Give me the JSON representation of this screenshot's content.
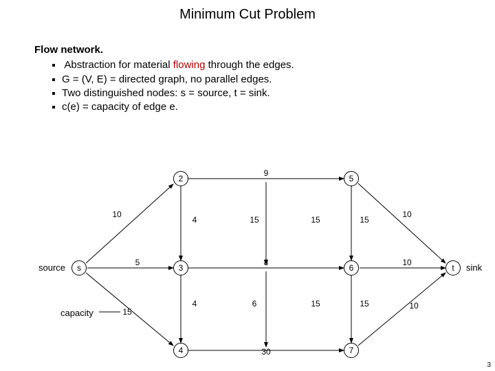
{
  "title": "Minimum Cut Problem",
  "heading": "Flow network.",
  "bullets": [
    {
      "pre": "Abstraction for material ",
      "em": "flowing",
      "post": " through the edges."
    },
    {
      "pre": "G = (V, E) = directed graph, no parallel edges.",
      "em": "",
      "post": ""
    },
    {
      "pre": "Two distinguished nodes:  s = source, t = sink.",
      "em": "",
      "post": ""
    },
    {
      "pre": "c(e) = capacity of edge e.",
      "em": "",
      "post": ""
    }
  ],
  "labels": {
    "source": "source",
    "sink": "sink",
    "capacity": "capacity"
  },
  "nodes": {
    "s": "s",
    "2": "2",
    "3": "3",
    "4": "4",
    "5": "5",
    "6": "6",
    "7": "7",
    "t": "t"
  },
  "edges": {
    "s_2": "10",
    "s_3": "5",
    "s_4": "15",
    "2_3": "4",
    "3_4": "4",
    "2_5": "9",
    "3_6": "8",
    "4_7": "30",
    "2_9_mid_a": "15",
    "2_9_mid_b": "15",
    "3_6_mid_a": "6",
    "3_6_mid_b": "15",
    "5_t": "10",
    "6_t": "10",
    "7_t": "10",
    "5_6": "15",
    "6_7": "15"
  },
  "page": "3"
}
